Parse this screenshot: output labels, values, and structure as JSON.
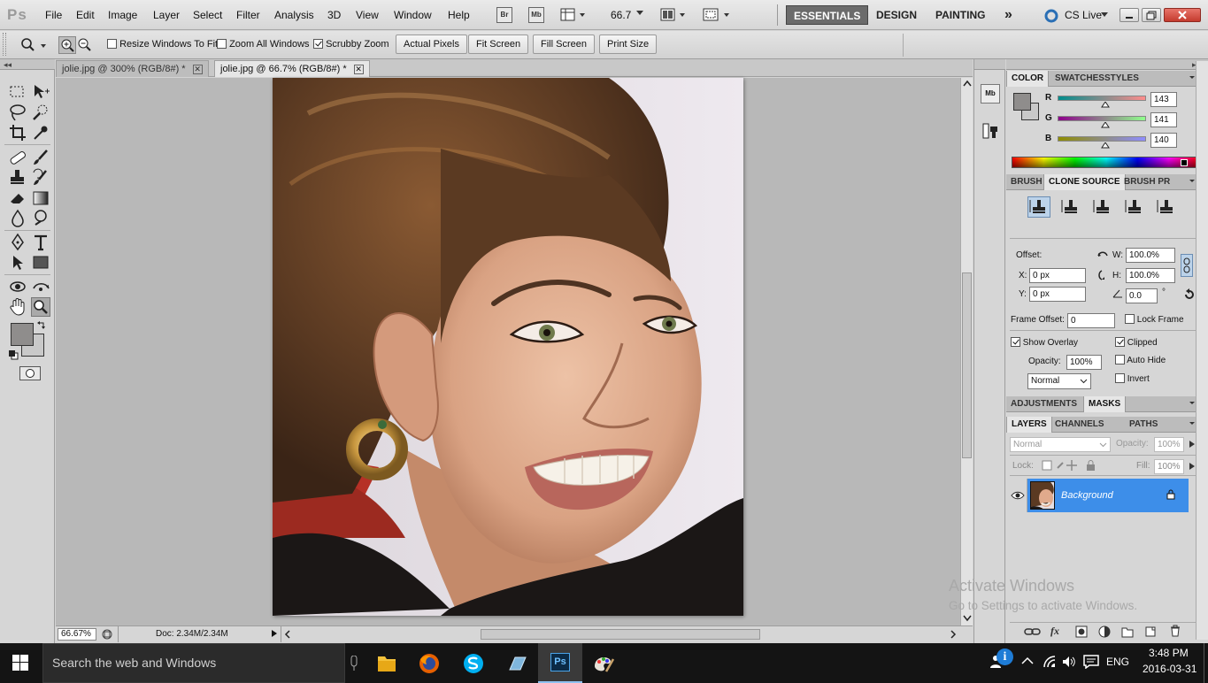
{
  "app": {
    "logo": "Ps"
  },
  "menu": [
    "File",
    "Edit",
    "Image",
    "Layer",
    "Select",
    "Filter",
    "Analysis",
    "3D",
    "View",
    "Window",
    "Help"
  ],
  "menubar_tools": {
    "bridge": "Br",
    "minibridge": "Mb",
    "zoom_value": "66.7"
  },
  "workspaces": {
    "essentials": "ESSENTIALS",
    "design": "DESIGN",
    "painting": "PAINTING",
    "more": "»",
    "cs_live": "CS Live"
  },
  "options": {
    "resize_windows": "Resize Windows To Fit",
    "resize_checked": false,
    "zoom_all": "Zoom All Windows",
    "zoom_all_checked": false,
    "scrubby": "Scrubby Zoom",
    "scrubby_checked": true,
    "actual_pixels": "Actual Pixels",
    "fit_screen": "Fit Screen",
    "fill_screen": "Fill Screen",
    "print_size": "Print Size"
  },
  "tabs": [
    {
      "label": "jolie.jpg @ 300% (RGB/8#) *",
      "active": false
    },
    {
      "label": "jolie.jpg @ 66.7% (RGB/8#) *",
      "active": true
    }
  ],
  "status": {
    "zoom": "66.67%",
    "doc": "Doc: 2.34M/2.34M"
  },
  "watermark": {
    "line1": "Activate Windows",
    "line2": "Go to Settings to activate Windows."
  },
  "color_panel": {
    "tabs": [
      "COLOR",
      "SWATCHES",
      "STYLES"
    ],
    "channels": [
      {
        "label": "R",
        "value": "143"
      },
      {
        "label": "G",
        "value": "141"
      },
      {
        "label": "B",
        "value": "140"
      }
    ],
    "fg_color": "#8f8d8c",
    "bg_color": "#c9c9c9"
  },
  "clone_panel": {
    "tabs": [
      "BRUSH",
      "CLONE SOURCE",
      "BRUSH PR"
    ],
    "offset_label": "Offset:",
    "w_label": "W:",
    "w_value": "100.0%",
    "h_label": "H:",
    "h_value": "100.0%",
    "x_label": "X:",
    "x_value": "0 px",
    "y_label": "Y:",
    "y_value": "0 px",
    "angle_value": "0.0",
    "angle_unit": "°",
    "frame_offset_label": "Frame Offset:",
    "frame_offset_value": "0",
    "lock_frame": "Lock Frame",
    "lock_frame_checked": false,
    "show_overlay": "Show Overlay",
    "show_overlay_checked": true,
    "clipped": "Clipped",
    "clipped_checked": true,
    "opacity_label": "Opacity:",
    "opacity_value": "100%",
    "auto_hide": "Auto Hide",
    "auto_hide_checked": false,
    "invert": "Invert",
    "invert_checked": false,
    "blend_mode": "Normal"
  },
  "adjust_panel": {
    "tabs": [
      "ADJUSTMENTS",
      "MASKS"
    ]
  },
  "layers_panel": {
    "tabs": [
      "LAYERS",
      "CHANNELS",
      "PATHS"
    ],
    "blend_mode": "Normal",
    "opacity_label": "Opacity:",
    "opacity_value": "100%",
    "lock_label": "Lock:",
    "fill_label": "Fill:",
    "fill_value": "100%",
    "layers": [
      {
        "name": "Background",
        "selected": true
      }
    ],
    "footer_fx": "fx"
  },
  "taskbar": {
    "search_placeholder": "Search the web and Windows",
    "lang": "ENG",
    "time": "3:48 PM",
    "date": "2016-03-31",
    "info_badge": "i"
  }
}
